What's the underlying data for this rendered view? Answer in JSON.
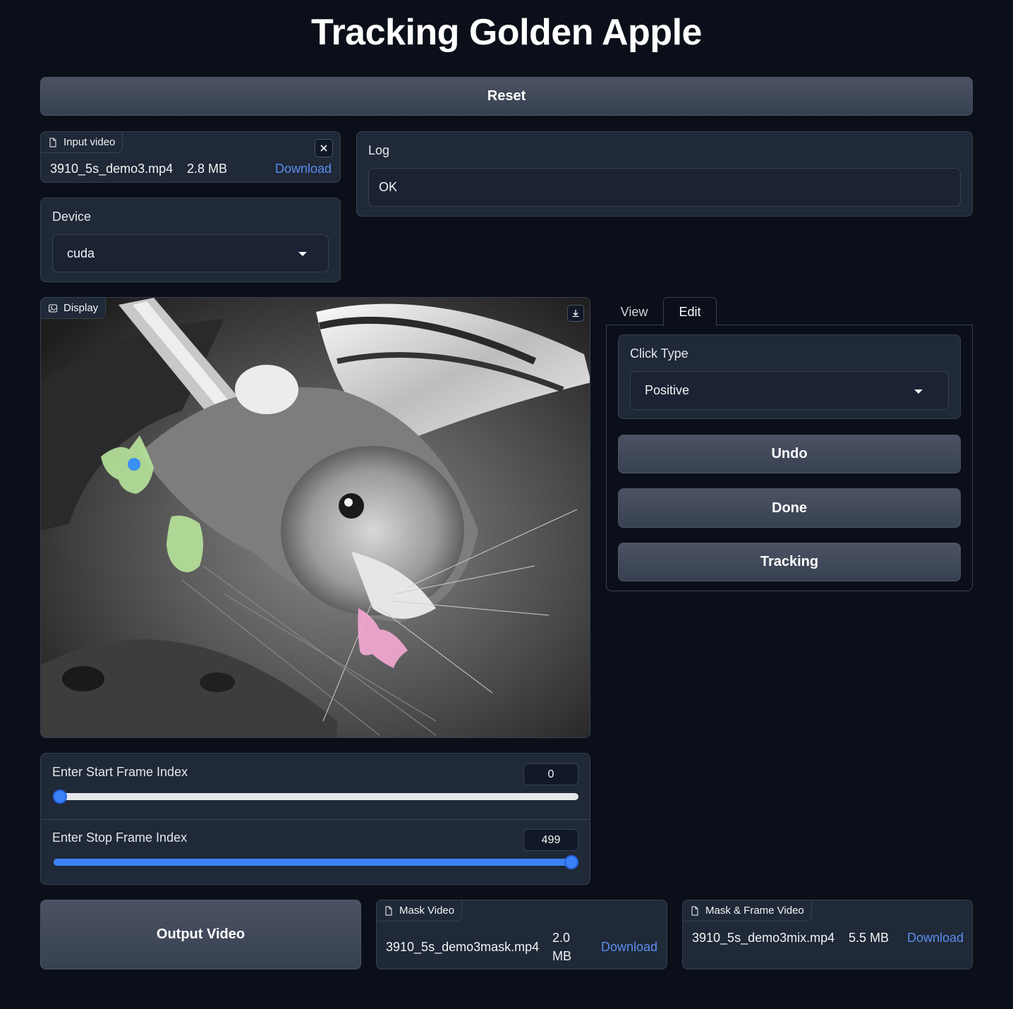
{
  "title": "Tracking Golden Apple",
  "reset_label": "Reset",
  "input_video": {
    "tag": "Input video",
    "filename": "3910_5s_demo3.mp4",
    "size": "2.8 MB",
    "download": "Download",
    "close_icon": "close-icon"
  },
  "device": {
    "label": "Device",
    "value": "cuda"
  },
  "log": {
    "label": "Log",
    "value": "OK"
  },
  "display": {
    "tag": "Display",
    "download_icon": "download-icon"
  },
  "tabs": [
    {
      "label": "View",
      "active": false
    },
    {
      "label": "Edit",
      "active": true
    }
  ],
  "click_type": {
    "label": "Click Type",
    "value": "Positive"
  },
  "buttons": {
    "undo": "Undo",
    "done": "Done",
    "tracking": "Tracking",
    "output_video": "Output Video"
  },
  "start_frame": {
    "label": "Enter Start Frame Index",
    "value": "0",
    "fraction": 0
  },
  "stop_frame": {
    "label": "Enter Stop Frame Index",
    "value": "499",
    "fraction": 1
  },
  "mask_video": {
    "tag": "Mask Video",
    "filename": "3910_5s_demo3mask.mp4",
    "size_num": "2.0",
    "size_unit": "MB",
    "download": "Download"
  },
  "mix_video": {
    "tag": "Mask & Frame Video",
    "filename": "3910_5s_demo3mix.mp4",
    "size": "5.5 MB",
    "download": "Download"
  },
  "colors": {
    "accent": "#3b82f6",
    "link": "#5b8def",
    "mask_green": "#b7e39b",
    "mask_pink": "#f2a7d0",
    "click_point": "#3b8ff0"
  }
}
